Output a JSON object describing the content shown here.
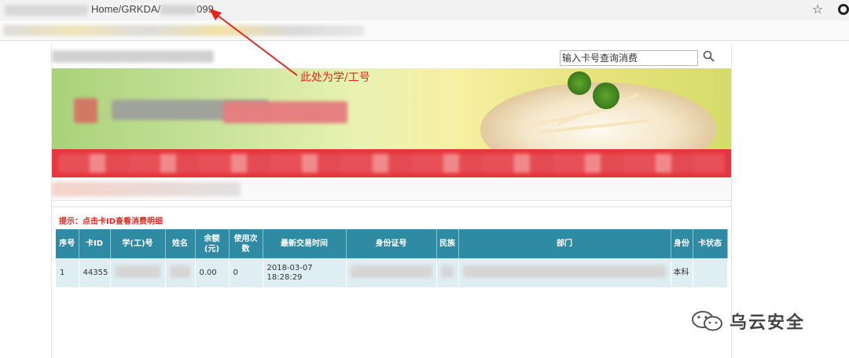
{
  "browser": {
    "url_visible_part": "Home/GRKDA/",
    "url_suffix": "099"
  },
  "search": {
    "placeholder": "输入卡号查询消费"
  },
  "annotation": {
    "text": "此处为学/工号"
  },
  "hint": {
    "text": "提示：点击卡ID查看消费明细"
  },
  "table": {
    "headers": [
      "序号",
      "卡ID",
      "学(工)号",
      "姓名",
      "余额(元)",
      "使用次数",
      "最新交易时间",
      "身份证号",
      "民族",
      "部门",
      "身份",
      "卡状态"
    ],
    "rows": [
      {
        "index": "1",
        "card_id": "44355",
        "student_id": "",
        "name": "",
        "balance": "0.00",
        "use_count": "0",
        "last_trade_date": "2018-03-07",
        "last_trade_time": "18:28:29",
        "id_number": "",
        "ethnicity": "",
        "department": "",
        "identity": "本科",
        "card_status": ""
      }
    ]
  },
  "watermark": {
    "text": "乌云安全"
  },
  "colors": {
    "table_header": "#2f8aa3",
    "table_row": "#dfeef3",
    "red_accent": "#e0261d",
    "banner_band": "#e7363f"
  }
}
